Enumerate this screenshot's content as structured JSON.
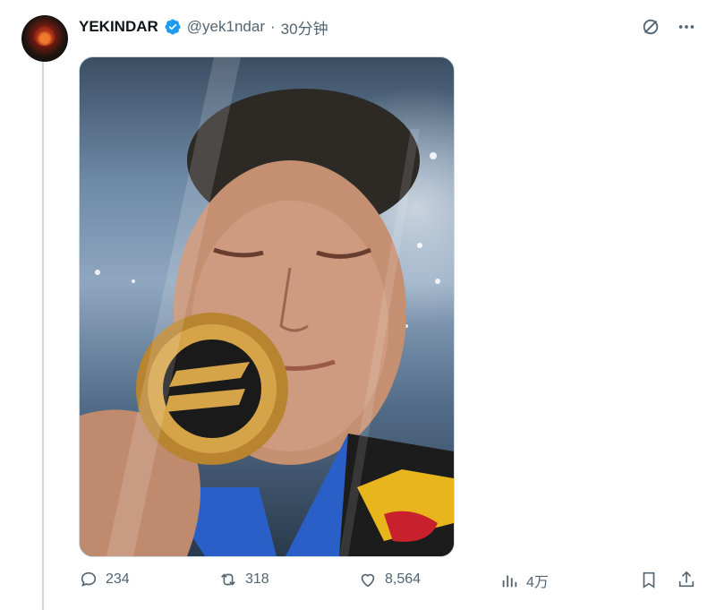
{
  "author": {
    "display_name": "YEKINDAR",
    "handle": "@yek1ndar",
    "separator": "·",
    "timestamp": "30分钟",
    "verified_icon": "verified-badge-icon",
    "verified_color": "#1d9bf0"
  },
  "header_icons": [
    "grok-icon",
    "more-icon"
  ],
  "media": {
    "description_icon": "photo"
  },
  "actions": {
    "replies": "234",
    "reposts": "318",
    "likes": "8,564",
    "views": "4万"
  },
  "colors": {
    "text_primary": "#0f1419",
    "text_secondary": "#536471",
    "border": "#cfd9de"
  }
}
